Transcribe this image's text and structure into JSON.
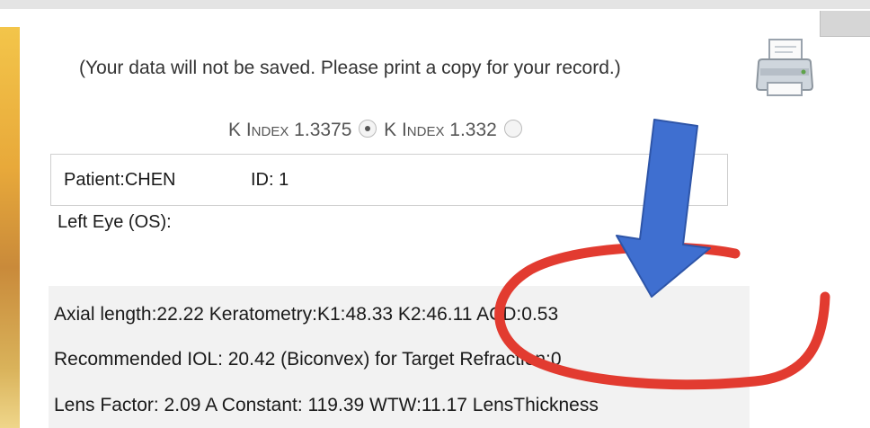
{
  "header": {
    "notice": "(Your data will not be saved.  Please print a copy for your record.)",
    "print_icon": "printer-icon"
  },
  "k_index": {
    "option1_label": "K Index 1.3375",
    "option2_label": "K Index 1.332",
    "selected": "option1"
  },
  "patient": {
    "name_label": "Patient:CHEN",
    "id_label": "ID: 1"
  },
  "eye": {
    "label": "Left Eye (OS):"
  },
  "results": {
    "line1": "Axial length:22.22  Keratometry:K1:48.33 K2:46.11  ACD:0.53",
    "line2": "Recommended IOL: 20.42 (Biconvex) for Target Refraction:0",
    "line3": "Lens Factor: 2.09 A Constant: 119.39 WTW:11.17 LensThickness"
  },
  "annotations": {
    "arrow_color": "#3f6fd0",
    "circle_color": "#e23b30"
  }
}
